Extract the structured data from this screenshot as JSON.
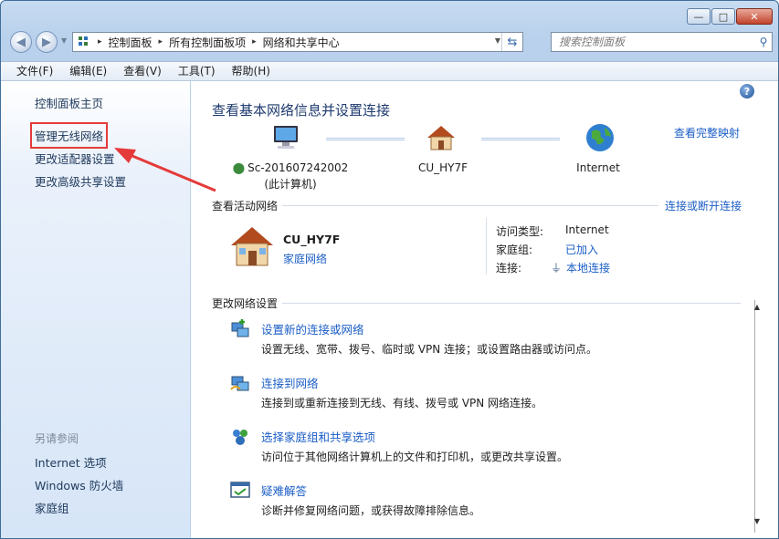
{
  "window": {
    "caption_buttons": {
      "minimize": "—",
      "maximize": "□",
      "close": "✕"
    }
  },
  "address": {
    "crumbs": [
      "控制面板",
      "所有控制面板项",
      "网络和共享中心"
    ],
    "separator": "▸",
    "search_placeholder": "搜索控制面板"
  },
  "menu": [
    "文件(F)",
    "编辑(E)",
    "查看(V)",
    "工具(T)",
    "帮助(H)"
  ],
  "sidebar": {
    "items": [
      "控制面板主页",
      "管理无线网络",
      "更改适配器设置",
      "更改高级共享设置"
    ],
    "see_also_heading": "另请参阅",
    "see_also": [
      "Internet 选项",
      "Windows 防火墙",
      "家庭组"
    ]
  },
  "main": {
    "title": "查看基本网络信息并设置连接",
    "full_map_link": "查看完整映射",
    "nodes": {
      "computer_name": "Sc-201607242002",
      "computer_sub": "(此计算机)",
      "network": "CU_HY7F",
      "internet": "Internet"
    },
    "active": {
      "heading": "查看活动网络",
      "connect_link": "连接或断开连接",
      "network_name": "CU_HY7F",
      "network_type": "家庭网络",
      "access_label": "访问类型:",
      "access_value": "Internet",
      "homegroup_label": "家庭组:",
      "homegroup_value": "已加入",
      "connection_label": "连接:",
      "connection_value": "本地连接"
    },
    "change": {
      "heading": "更改网络设置",
      "tasks": [
        {
          "title": "设置新的连接或网络",
          "desc": "设置无线、宽带、拨号、临时或 VPN 连接；或设置路由器或访问点。"
        },
        {
          "title": "连接到网络",
          "desc": "连接到或重新连接到无线、有线、拨号或 VPN 网络连接。"
        },
        {
          "title": "选择家庭组和共享选项",
          "desc": "访问位于其他网络计算机上的文件和打印机，或更改共享设置。"
        },
        {
          "title": "疑难解答",
          "desc": "诊断并修复网络问题，或获得故障排除信息。"
        }
      ]
    }
  },
  "colors": {
    "link": "#1b5ec6",
    "annotation": "#e53a3a"
  }
}
